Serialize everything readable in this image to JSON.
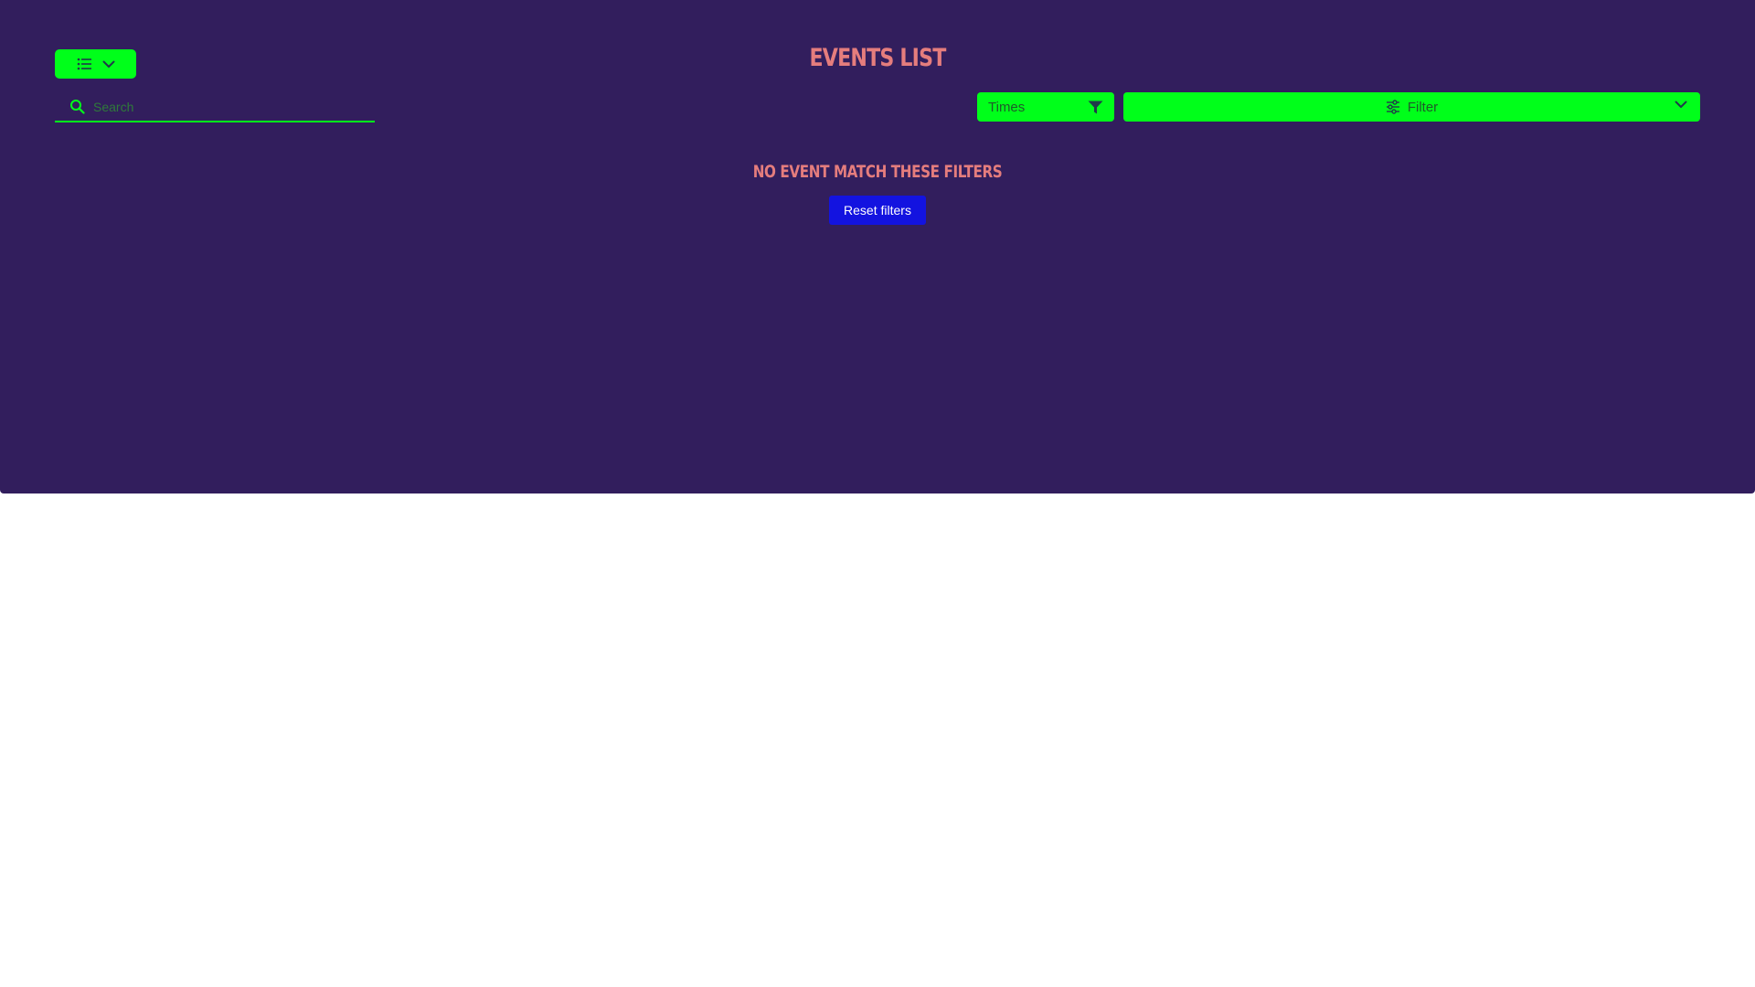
{
  "header": {
    "title": "Events list"
  },
  "view_toggle": {
    "icon": "list-icon",
    "chevron_icon": "chevron-down-icon"
  },
  "search": {
    "placeholder": "Search",
    "value": "",
    "icon": "search-icon"
  },
  "times_filter": {
    "label": "Times",
    "icon": "funnel-icon"
  },
  "filter_dropdown": {
    "label": "Filter",
    "icon": "sliders-icon",
    "chevron_icon": "chevron-down-icon"
  },
  "empty_state": {
    "message": "No event match these filters",
    "reset_label": "Reset filters"
  },
  "colors": {
    "background": "#321e5d",
    "accent_green": "#00ff1a",
    "title_color": "#e57d7d",
    "button_blue": "#1313e0"
  }
}
